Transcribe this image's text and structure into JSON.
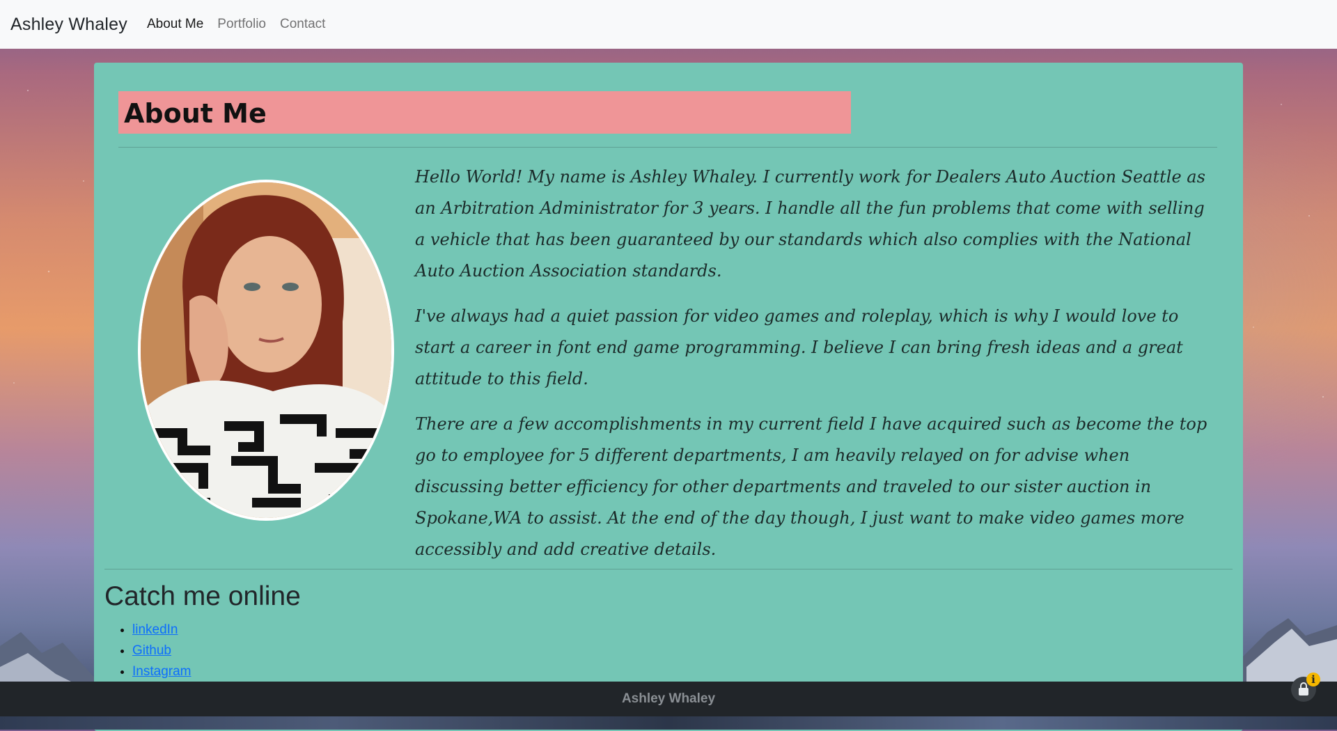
{
  "navbar": {
    "brand": "Ashley Whaley",
    "links": [
      "About Me",
      "Portfolio",
      "Contact"
    ],
    "active": "About Me"
  },
  "about": {
    "title": "About Me",
    "paragraphs": [
      "Hello World! My name is Ashley Whaley. I currently work for Dealers Auto Auction Seattle as an Arbitration Administrator for 3 years. I handle all the fun problems that come with selling a vehicle that has been guaranteed by our standards which also complies with the National Auto Auction Association standards.",
      "I've always had a quiet passion for video games and roleplay, which is why I would love to start a career in font end game programming. I believe I can bring fresh ideas and a great attitude to this field.",
      "There are a few accomplishments in my current field I have acquired such as become the top go to employee for 5 different departments, I am heavily relayed on for advise when discussing better efficiency for other departments and traveled to our sister auction in Spokane,WA to assist. At the end of the day though, I just want to make video games more accessibly and add creative details."
    ]
  },
  "online": {
    "title": "Catch me online",
    "links": [
      "linkedIn",
      "Github",
      "Instagram"
    ]
  },
  "footer": {
    "text": "Ashley Whaley"
  },
  "colors": {
    "card": "#74c6b5",
    "title_bar": "#ef9597",
    "footer": "#212529",
    "link": "#0d6efd"
  },
  "icons": {
    "lock": "lock-icon",
    "info": "info-icon"
  },
  "info_badge": "i"
}
